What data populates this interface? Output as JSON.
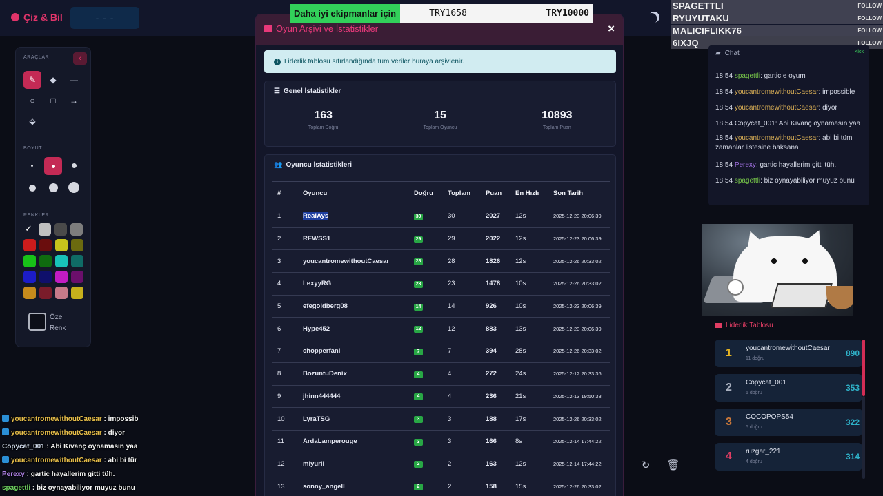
{
  "app": {
    "title": "Çiz & Bil",
    "word_hint": "- - -"
  },
  "banner": {
    "lead": "Daha iyi ekipmanlar için",
    "mid": "TRY1658",
    "right": "TRY10000"
  },
  "followers": [
    {
      "name": "SPAGETTLI",
      "action": "FOLLOW"
    },
    {
      "name": "RYUYUTAKU",
      "action": "FOLLOW"
    },
    {
      "name": "MALICIFLIKK76",
      "action": "FOLLOW"
    },
    {
      "name": "6IXJQ",
      "action": "FOLLOW"
    }
  ],
  "tools": {
    "section_tools": "ARAÇLAR",
    "section_size": "BOYUT",
    "section_colors": "RENKLER",
    "custom_color_line1": "Özel",
    "custom_color_line2": "Renk",
    "colors": [
      "#c0c0c0",
      "#4a4a4a",
      "#7d7d7d",
      "#cc1c1c",
      "#6a0d0d",
      "#c7c41c",
      "#6b6a0f",
      "#18c218",
      "#0f6b0f",
      "#18c2b8",
      "#0f6b66",
      "#1c1cc8",
      "#0f0f6b",
      "#c21cc2",
      "#6b0f6b",
      "#c78b1c",
      "#7a1c2a",
      "#c77a8a",
      "#c7b01c"
    ]
  },
  "modal": {
    "title": "Oyun Arşivi ve İstatistikler",
    "close": "×",
    "info": "Liderlik tablosu sıfırlandığında tüm veriler buraya arşivlenir.",
    "general_title": "Genel İstatistikler",
    "general_stats": [
      {
        "value": "163",
        "label": "Toplam Doğru"
      },
      {
        "value": "15",
        "label": "Toplam Oyuncu"
      },
      {
        "value": "10893",
        "label": "Toplam Puan"
      }
    ],
    "players_title": "Oyuncu İstatistikleri",
    "columns": [
      "#",
      "Oyuncu",
      "Doğru",
      "Toplam",
      "Puan",
      "En Hızlı",
      "Son Tarih"
    ],
    "rows": [
      [
        "1",
        "RealAys",
        "30",
        "30",
        "2027",
        "12s",
        "2025-12-23 20:06:39"
      ],
      [
        "2",
        "REWSS1",
        "29",
        "29",
        "2022",
        "12s",
        "2025-12-23 20:06:39"
      ],
      [
        "3",
        "youcantromewithoutCaesar",
        "28",
        "28",
        "1826",
        "12s",
        "2025-12-26 20:33:02"
      ],
      [
        "4",
        "LexyyRG",
        "23",
        "23",
        "1478",
        "10s",
        "2025-12-26 20:33:02"
      ],
      [
        "5",
        "efegoldberg08",
        "14",
        "14",
        "926",
        "10s",
        "2025-12-23 20:06:39"
      ],
      [
        "6",
        "Hype452",
        "12",
        "12",
        "883",
        "13s",
        "2025-12-23 20:06:39"
      ],
      [
        "7",
        "chopperfani",
        "7",
        "7",
        "394",
        "28s",
        "2025-12-26 20:33:02"
      ],
      [
        "8",
        "BozuntuDenix",
        "4",
        "4",
        "272",
        "24s",
        "2025-12-12 20:33:36"
      ],
      [
        "9",
        "jhinn444444",
        "4",
        "4",
        "236",
        "21s",
        "2025-12-13 19:50:38"
      ],
      [
        "10",
        "LyraTSG",
        "3",
        "3",
        "188",
        "17s",
        "2025-12-26 20:33:02"
      ],
      [
        "11",
        "ArdaLamperouge",
        "3",
        "3",
        "166",
        "8s",
        "2025-12-14 17:44:22"
      ],
      [
        "12",
        "miyurii",
        "2",
        "2",
        "163",
        "12s",
        "2025-12-14 17:44:22"
      ],
      [
        "13",
        "sonny_angell",
        "2",
        "2",
        "158",
        "15s",
        "2025-12-26 20:33:02"
      ]
    ]
  },
  "chat": {
    "title": "Chat",
    "badge": "Kick",
    "messages": [
      {
        "time": "18:54",
        "user": "spagettli",
        "text": ": gartic e oyum",
        "color": "g"
      },
      {
        "time": "18:54",
        "user": "youcantromewithoutCaesar",
        "text": ": impossible",
        "color": "y"
      },
      {
        "time": "18:54",
        "user": "youcantromewithoutCaesar",
        "text": ": diyor",
        "color": "y"
      },
      {
        "time": "18:54",
        "user": "Copycat_001",
        "text": ": Abi Kıvanç oynamasın yaa",
        "color": "w"
      },
      {
        "time": "18:54",
        "user": "youcantromewithoutCaesar",
        "text": ": abi bi tüm zamanlar listesine baksana",
        "color": "y"
      },
      {
        "time": "18:54",
        "user": "Perexy",
        "text": ": gartic hayallerim gitti tüh.",
        "color": "p"
      },
      {
        "time": "18:54",
        "user": "spagettli",
        "text": ": biz oynayabiliyor muyuz bunu",
        "color": "g"
      }
    ]
  },
  "leaderboard": {
    "title": "Liderlik Tablosu",
    "items": [
      {
        "rank": "1",
        "name": "youcantromewithoutCaesar",
        "sub": "11 doğru",
        "score": "890",
        "rank_color": "#e6b422"
      },
      {
        "rank": "2",
        "name": "Copycat_001",
        "sub": "5 doğru",
        "score": "353",
        "rank_color": "#a9b0bf"
      },
      {
        "rank": "3",
        "name": "COCOPOPS54",
        "sub": "5 doğru",
        "score": "322",
        "rank_color": "#c9783a"
      },
      {
        "rank": "4",
        "name": "ruzgar_221",
        "sub": "4 doğru",
        "score": "314",
        "rank_color": "#e03d63"
      }
    ]
  },
  "overlay_chat": [
    {
      "user": "youcantromewithoutCaesar",
      "text": " : impossib",
      "cls": "oy",
      "kick": true
    },
    {
      "user": "youcantromewithoutCaesar",
      "text": " : diyor",
      "cls": "oy",
      "kick": true
    },
    {
      "user": "Copycat_001",
      "text": " : Abi Kıvanç oynamasın yaa",
      "cls": "oc",
      "kick": false
    },
    {
      "user": "youcantromewithoutCaesar",
      "text": " : abi bi tür",
      "cls": "oy",
      "kick": true
    },
    {
      "user": "Perexy",
      "text": " : gartic hayallerim gitti tüh.",
      "cls": "op",
      "kick": false
    },
    {
      "user": "spagettli",
      "text": " : biz oynayabiliyor muyuz bunu",
      "cls": "og",
      "kick": false
    }
  ]
}
